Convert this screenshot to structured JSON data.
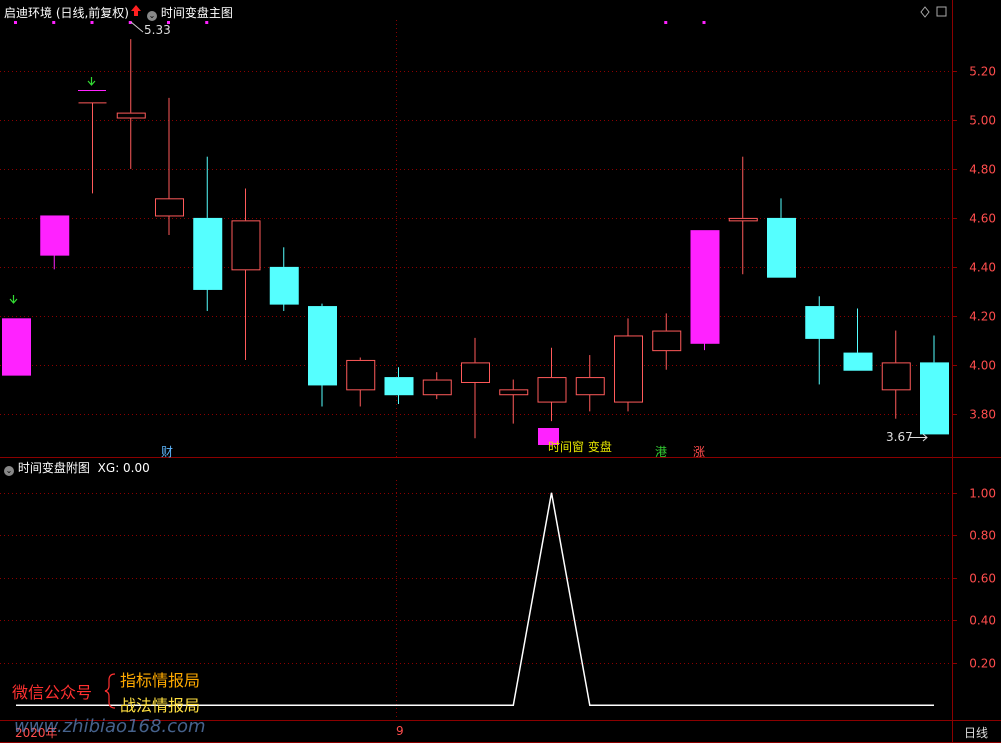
{
  "main_panel": {
    "stock_label": "启迪环境 (日线,前复权)",
    "indicator_name": "时间变盘主图",
    "price_high_label": "5.33",
    "price_low_label": "3.67",
    "markers": [
      {
        "text": "财",
        "color": "#5fb8ff"
      },
      {
        "text": "时间窗 变盘",
        "color": "#e6e600"
      },
      {
        "text": "港",
        "color": "#33cc33"
      },
      {
        "text": "涨",
        "color": "#ff4d4d"
      }
    ]
  },
  "sub_panel": {
    "title": "时间变盘附图",
    "xg_label": "XG: 0.00"
  },
  "x_axis": {
    "year_label": "2020年",
    "month_label": "9",
    "period_button": "日线"
  },
  "watermark": {
    "line1": "微信公众号",
    "item1": "指标情报局",
    "item2": "战法情报局",
    "url": "www.zhibiao168.com"
  },
  "colors": {
    "up": "#ff5a5a",
    "down_cyan": "#55ffff",
    "limit_magenta": "#ff22ff",
    "grid": "#8b0000",
    "axis_text": "#ff4d4d"
  },
  "chart_data": [
    {
      "type": "candlestick",
      "title": "时间变盘主图",
      "ylim": [
        3.64,
        5.4
      ],
      "y_ticks": [
        3.8,
        4.0,
        4.2,
        4.4,
        4.6,
        4.8,
        5.0,
        5.2
      ],
      "candles": [
        {
          "o": 3.96,
          "h": 4.19,
          "l": 3.96,
          "c": 4.19,
          "color": "magenta"
        },
        {
          "o": 4.45,
          "h": 4.61,
          "l": 4.39,
          "c": 4.61,
          "color": "magenta"
        },
        {
          "o": 5.07,
          "h": 5.07,
          "l": 4.7,
          "c": 5.07,
          "color": "doji"
        },
        {
          "o": 5.01,
          "h": 5.33,
          "l": 4.8,
          "c": 5.03,
          "color": "up"
        },
        {
          "o": 4.61,
          "h": 5.09,
          "l": 4.53,
          "c": 4.68,
          "color": "up"
        },
        {
          "o": 4.6,
          "h": 4.85,
          "l": 4.22,
          "c": 4.31,
          "color": "down"
        },
        {
          "o": 4.39,
          "h": 4.72,
          "l": 4.02,
          "c": 4.59,
          "color": "up"
        },
        {
          "o": 4.4,
          "h": 4.48,
          "l": 4.22,
          "c": 4.25,
          "color": "down"
        },
        {
          "o": 4.24,
          "h": 4.25,
          "l": 3.83,
          "c": 3.92,
          "color": "down"
        },
        {
          "o": 3.9,
          "h": 4.03,
          "l": 3.83,
          "c": 4.02,
          "color": "up"
        },
        {
          "o": 3.95,
          "h": 3.99,
          "l": 3.84,
          "c": 3.88,
          "color": "down"
        },
        {
          "o": 3.88,
          "h": 3.97,
          "l": 3.86,
          "c": 3.94,
          "color": "up"
        },
        {
          "o": 3.93,
          "h": 4.11,
          "l": 3.7,
          "c": 4.01,
          "color": "up"
        },
        {
          "o": 3.88,
          "h": 3.94,
          "l": 3.76,
          "c": 3.9,
          "color": "up"
        },
        {
          "o": 3.85,
          "h": 4.07,
          "l": 3.77,
          "c": 3.95,
          "color": "up"
        },
        {
          "o": 3.88,
          "h": 4.04,
          "l": 3.81,
          "c": 3.95,
          "color": "up"
        },
        {
          "o": 3.85,
          "h": 4.19,
          "l": 3.81,
          "c": 4.12,
          "color": "up"
        },
        {
          "o": 4.06,
          "h": 4.21,
          "l": 3.98,
          "c": 4.14,
          "color": "up"
        },
        {
          "o": 4.09,
          "h": 4.55,
          "l": 4.06,
          "c": 4.55,
          "color": "magenta"
        },
        {
          "o": 4.59,
          "h": 4.85,
          "l": 4.37,
          "c": 4.6,
          "color": "doji"
        },
        {
          "o": 4.6,
          "h": 4.68,
          "l": 4.36,
          "c": 4.36,
          "color": "down"
        },
        {
          "o": 4.24,
          "h": 4.28,
          "l": 3.92,
          "c": 4.11,
          "color": "down"
        },
        {
          "o": 4.05,
          "h": 4.23,
          "l": 3.98,
          "c": 3.98,
          "color": "down"
        },
        {
          "o": 3.9,
          "h": 4.14,
          "l": 3.78,
          "c": 4.01,
          "color": "up"
        },
        {
          "o": 4.01,
          "h": 4.12,
          "l": 3.72,
          "c": 3.72,
          "color": "down"
        }
      ]
    },
    {
      "type": "line",
      "title": "时间变盘附图",
      "series": [
        {
          "name": "XG",
          "values": [
            0,
            0,
            0,
            0,
            0,
            0,
            0,
            0,
            0,
            0,
            0,
            0,
            0,
            0,
            1,
            0,
            0,
            0,
            0,
            0,
            0,
            0,
            0,
            0,
            0
          ]
        }
      ],
      "ylim": [
        -0.06,
        1.06
      ],
      "y_ticks": [
        "0.20",
        "0.40",
        "0.60",
        "0.80",
        "1.00"
      ]
    }
  ]
}
